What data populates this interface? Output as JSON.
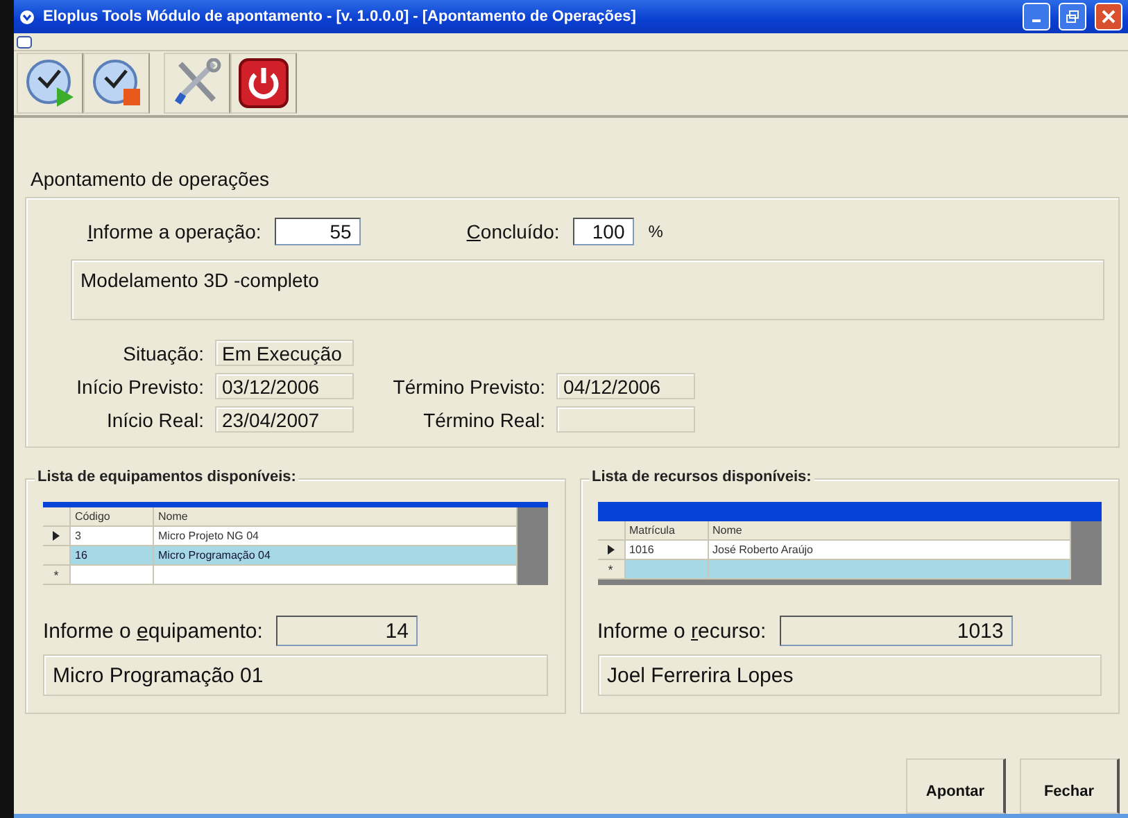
{
  "window": {
    "title": "Eloplus Tools Módulo de apontamento - [v. 1.0.0.0] - [Apontamento de Operações]"
  },
  "section_title": "Apontamento de operações",
  "operation": {
    "label": {
      "key": "I",
      "after": "nforme a operação:"
    },
    "value": "55",
    "editable": true
  },
  "completed": {
    "label": {
      "key": "C",
      "after": "oncluído:"
    },
    "value": "100",
    "unit": "%",
    "editable": true
  },
  "operation_description": "Modelamento 3D -completo",
  "status_fields": [
    {
      "label": "Situação:",
      "value": "Em Execução"
    },
    {
      "label": "Início Previsto:",
      "value": "03/12/2006",
      "extra_label": "Término Previsto:",
      "extra_value": "04/12/2006"
    },
    {
      "label": "Início Real:",
      "value": "23/04/2007",
      "extra_label": "Término Real:"
    }
  ],
  "panels": [
    {
      "title": "Lista de equipamentos disponíveis:",
      "columns": [
        "Código",
        "Nome"
      ],
      "rows": [
        {
          "cells": [
            "3",
            "Micro Projeto NG 04"
          ],
          "current": true,
          "selected": false
        },
        {
          "cells": [
            "16",
            "Micro Programação 04"
          ],
          "current": false,
          "selected": true
        }
      ],
      "new_row": {
        "marker": "*",
        "selected": false
      },
      "input": {
        "label": {
          "before": "Informe o ",
          "key": "e",
          "after": "quipamento:"
        },
        "value": "14",
        "editable": false
      },
      "description": "Micro Programação 01"
    },
    {
      "title": "Lista de recursos disponíveis:",
      "columns": [
        "Matrícula",
        "Nome"
      ],
      "rows": [
        {
          "cells": [
            "1016",
            "José Roberto Araújo"
          ],
          "current": true,
          "selected": false
        }
      ],
      "new_row": {
        "marker": "*",
        "selected": true
      },
      "input": {
        "label": {
          "before": "Informe o ",
          "key": "r",
          "after": "ecurso:"
        },
        "value": "1013",
        "editable": false
      },
      "description": "Joel Ferrerira Lopes"
    }
  ],
  "buttons": [
    "Apontar",
    "Fechar"
  ]
}
